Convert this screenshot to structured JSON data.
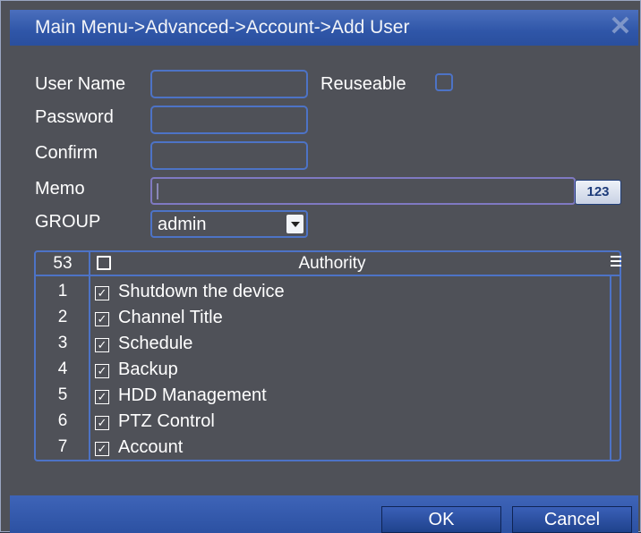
{
  "title": "Main Menu->Advanced->Account->Add User",
  "form": {
    "user_name_label": "User Name",
    "user_name_value": "",
    "reuseable_label": "Reuseable",
    "reuseable_checked": false,
    "password_label": "Password",
    "password_value": "",
    "confirm_label": "Confirm",
    "confirm_value": "",
    "memo_label": "Memo",
    "memo_value": "",
    "keyboard_button": "123",
    "group_label": "GROUP",
    "group_value": "admin"
  },
  "authority": {
    "count": "53",
    "header": "Authority",
    "rows": [
      {
        "num": "1",
        "label": "Shutdown the device",
        "checked": true
      },
      {
        "num": "2",
        "label": "Channel Title",
        "checked": true
      },
      {
        "num": "3",
        "label": "Schedule",
        "checked": true
      },
      {
        "num": "4",
        "label": "Backup",
        "checked": true
      },
      {
        "num": "5",
        "label": "HDD Management",
        "checked": true
      },
      {
        "num": "6",
        "label": "PTZ Control",
        "checked": true
      },
      {
        "num": "7",
        "label": "Account",
        "checked": true
      }
    ]
  },
  "buttons": {
    "ok": "OK",
    "cancel": "Cancel"
  },
  "colors": {
    "title_bar": "#2f56a8",
    "panel": "#4f5158",
    "field_border": "#4d73c6"
  }
}
